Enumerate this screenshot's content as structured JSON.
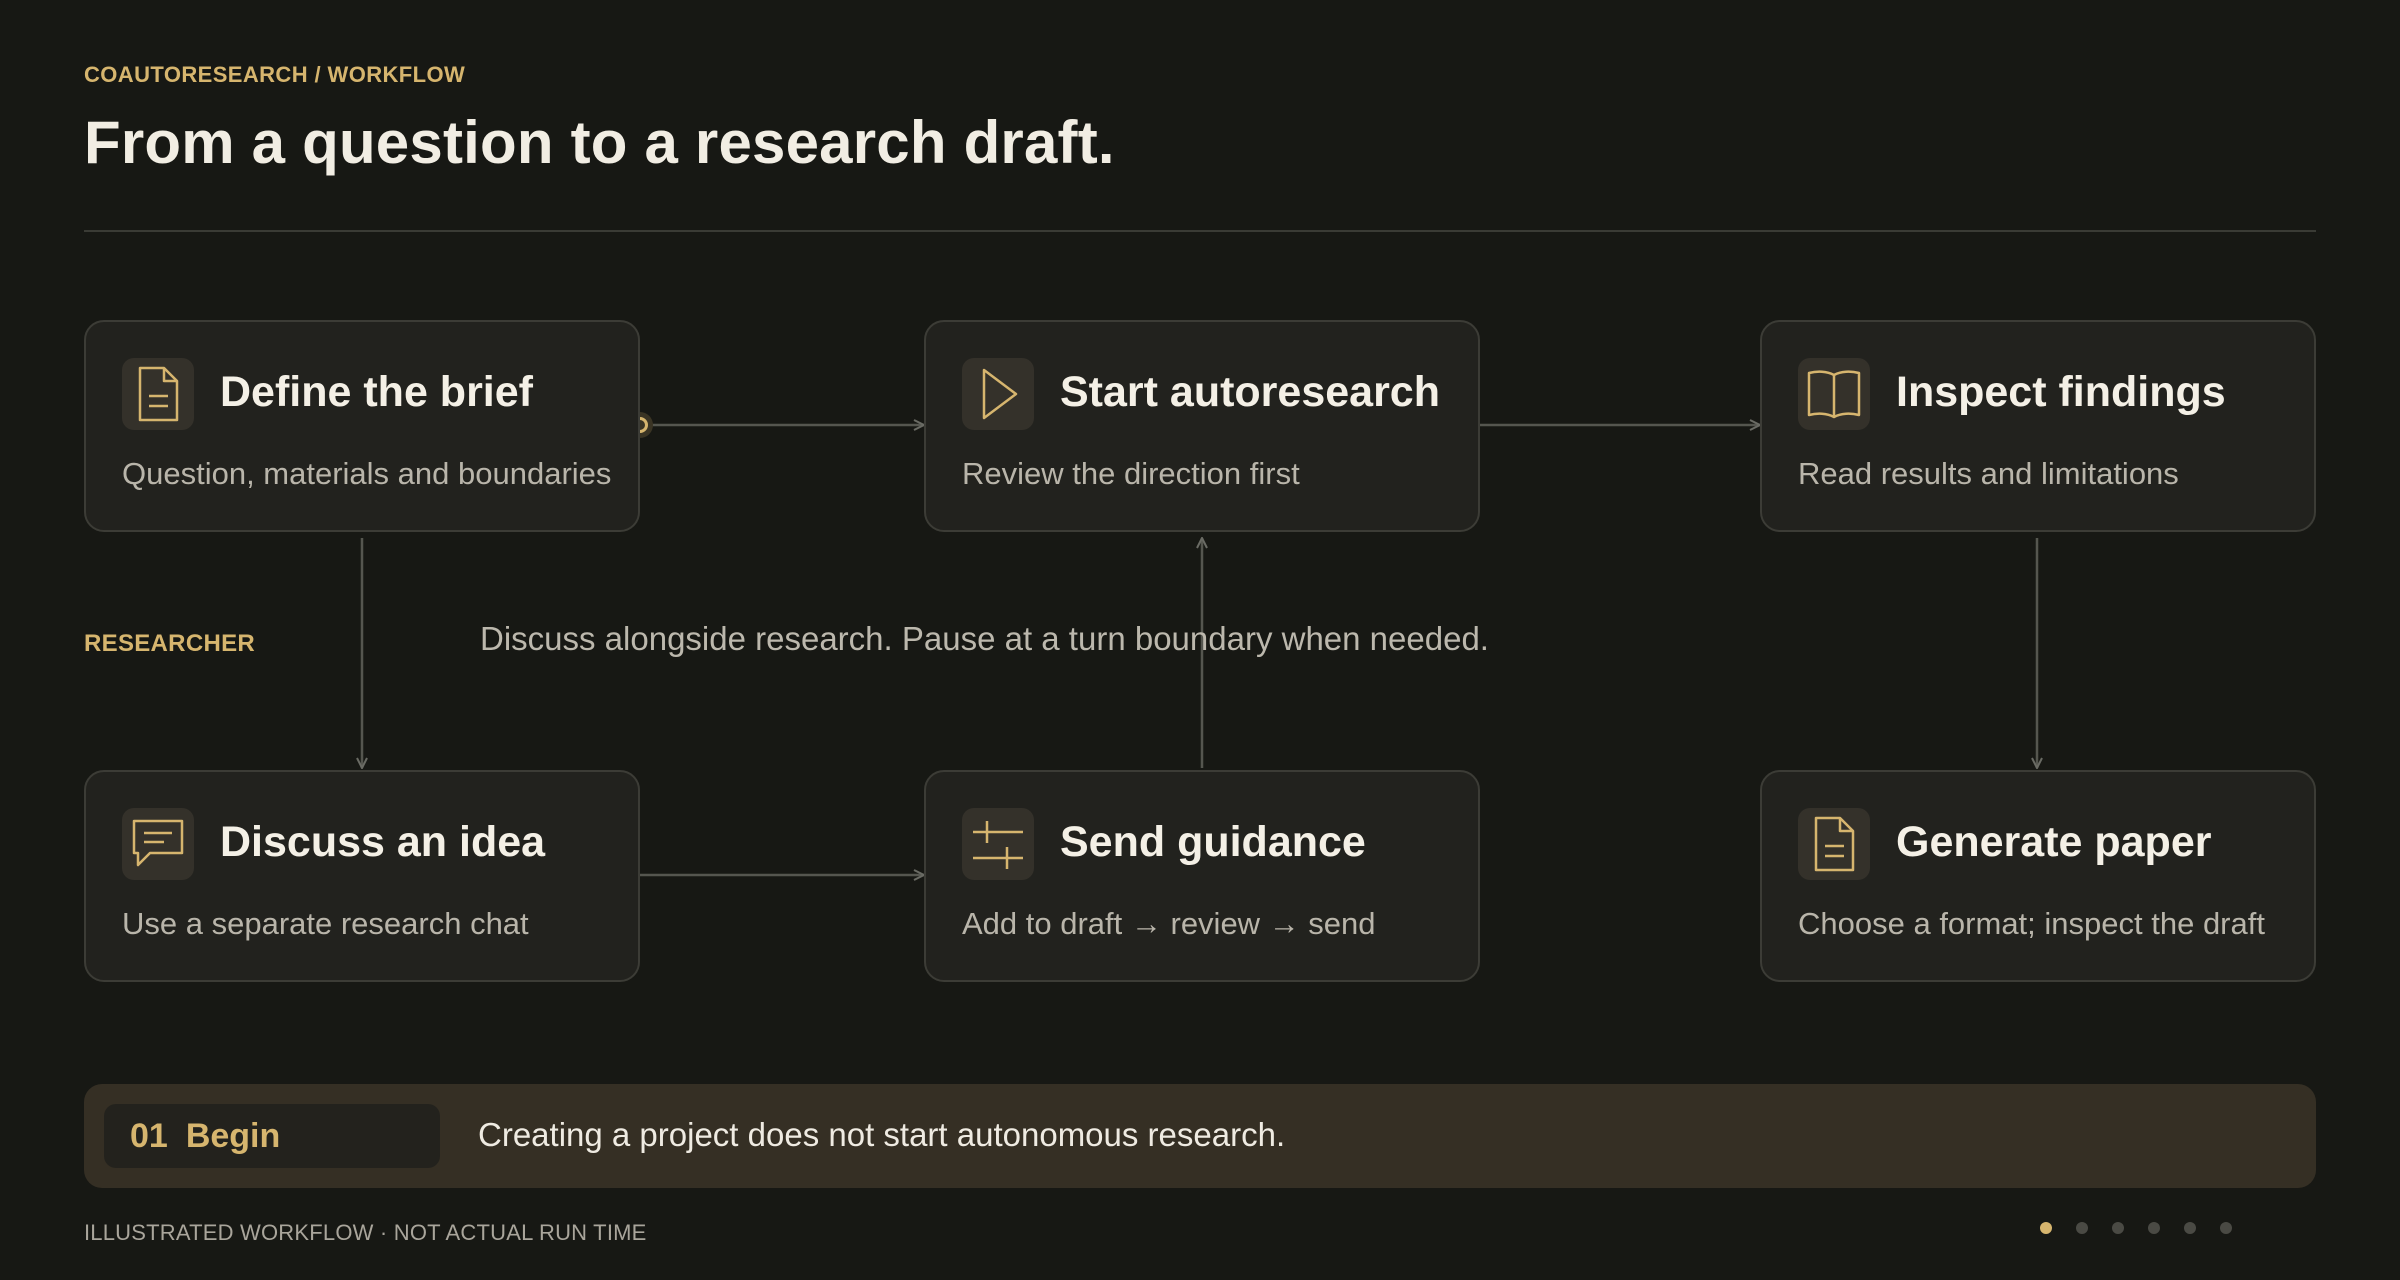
{
  "header": {
    "eyebrow": "COAUTORESEARCH / WORKFLOW",
    "title": "From a question to a research draft."
  },
  "nodes": {
    "define": {
      "title": "Define the brief",
      "subtitle": "Question, materials and boundaries",
      "icon": "document-icon"
    },
    "start": {
      "title": "Start autoresearch",
      "subtitle": "Review the direction first",
      "icon": "play-icon"
    },
    "inspect": {
      "title": "Inspect findings",
      "subtitle": "Read results and limitations",
      "icon": "book-icon"
    },
    "discuss": {
      "title": "Discuss an idea",
      "subtitle": "Use a separate research chat",
      "icon": "chat-icon"
    },
    "guidance": {
      "title": "Send guidance",
      "subtitle": "Add to draft → review → send",
      "icon": "sliders-icon"
    },
    "paper": {
      "title": "Generate paper",
      "subtitle": "Choose a format; inspect the draft",
      "icon": "document-icon"
    }
  },
  "lane": {
    "role": "RESEARCHER",
    "note": "Discuss alongside research. Pause at a turn boundary when needed."
  },
  "banner": {
    "step_number": "01",
    "step_label": "Begin",
    "text": "Creating a project does not start autonomous research."
  },
  "footer": {
    "note": "ILLUSTRATED WORKFLOW · NOT ACTUAL RUN TIME",
    "pagination": {
      "total": 6,
      "active_index": 0
    }
  },
  "colors": {
    "background": "#171814",
    "accent": "#d6b56e",
    "card": "#22221e",
    "connector": "#55564f"
  }
}
